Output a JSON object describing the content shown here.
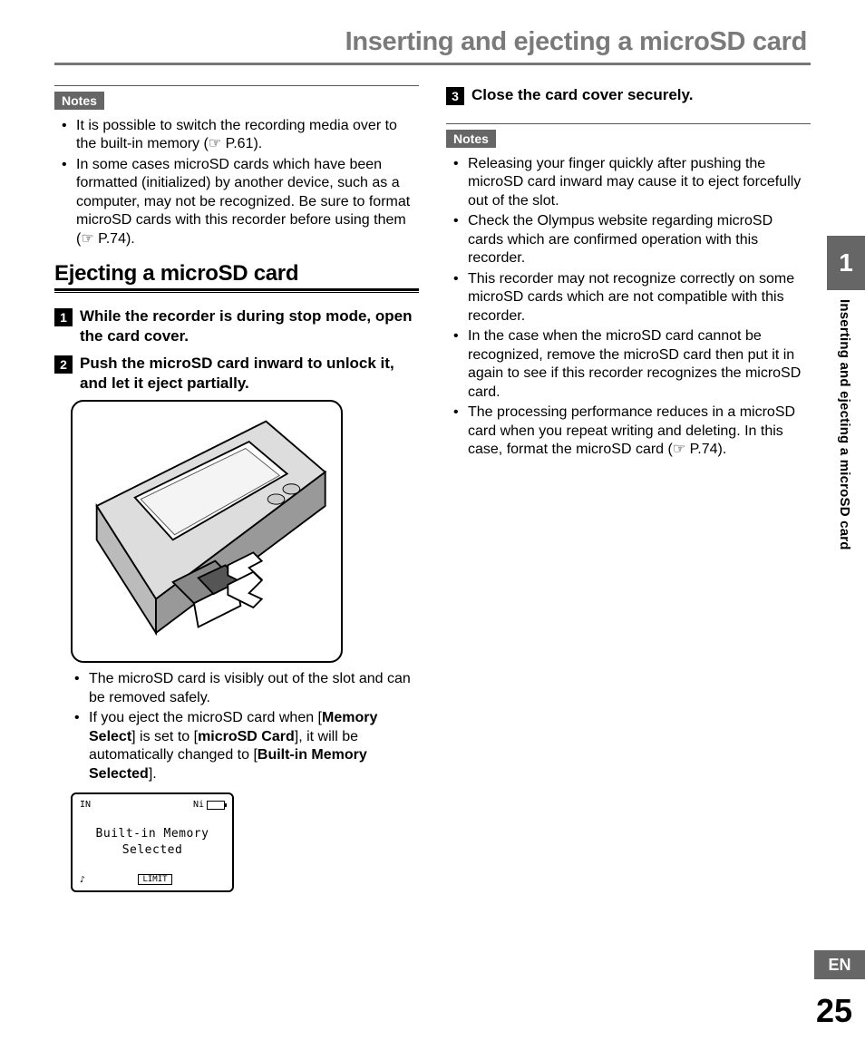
{
  "page_title": "Inserting and ejecting a microSD card",
  "sidebar": {
    "chapter_number": "1",
    "chapter_label": "Inserting and ejecting a microSD card",
    "language": "EN",
    "page_number": "25"
  },
  "left": {
    "notes_label": "Notes",
    "notes_items": [
      "It is possible to switch the recording media over to the built-in memory (☞ P.61).",
      "In some cases microSD cards which have been formatted (initialized) by another device, such as a computer, may not be recognized. Be sure to format microSD cards with this recorder before using them (☞ P.74)."
    ],
    "section_heading": "Ejecting a microSD card",
    "steps": [
      {
        "num": "1",
        "text": "While the recorder is during stop mode, open the card cover."
      },
      {
        "num": "2",
        "text": "Push the microSD card inward to unlock it, and let it eject partially."
      }
    ],
    "after_illus_items": [
      "The microSD card is visibly out of the slot and can be removed safely.",
      "If you eject the microSD card when [<b>Memory Select</b>] is set to [<b>microSD Card</b>], it will be automatically changed to [<b>Built-in Memory Selected</b>]."
    ],
    "lcd": {
      "top_left": "IN",
      "top_right_label": "Ni",
      "line1": "Built-in Memory",
      "line2": "Selected",
      "bottom_left": "♪",
      "bottom_badge": "LIMIT"
    }
  },
  "right": {
    "step": {
      "num": "3",
      "text": "Close the card cover securely."
    },
    "notes_label": "Notes",
    "notes_items": [
      "Releasing your finger quickly after pushing the microSD card inward may cause it to eject forcefully out of the slot.",
      "Check the Olympus website regarding microSD cards which are confirmed operation with this recorder.",
      "This recorder may not recognize correctly on some microSD cards which are not compatible with this recorder.",
      "In the case when the microSD card cannot be recognized, remove the microSD card then put it in again to see if this recorder recognizes the microSD card.",
      "The processing performance reduces in a microSD card when you repeat writing and deleting. In this case, format the microSD card (☞ P.74)."
    ]
  }
}
